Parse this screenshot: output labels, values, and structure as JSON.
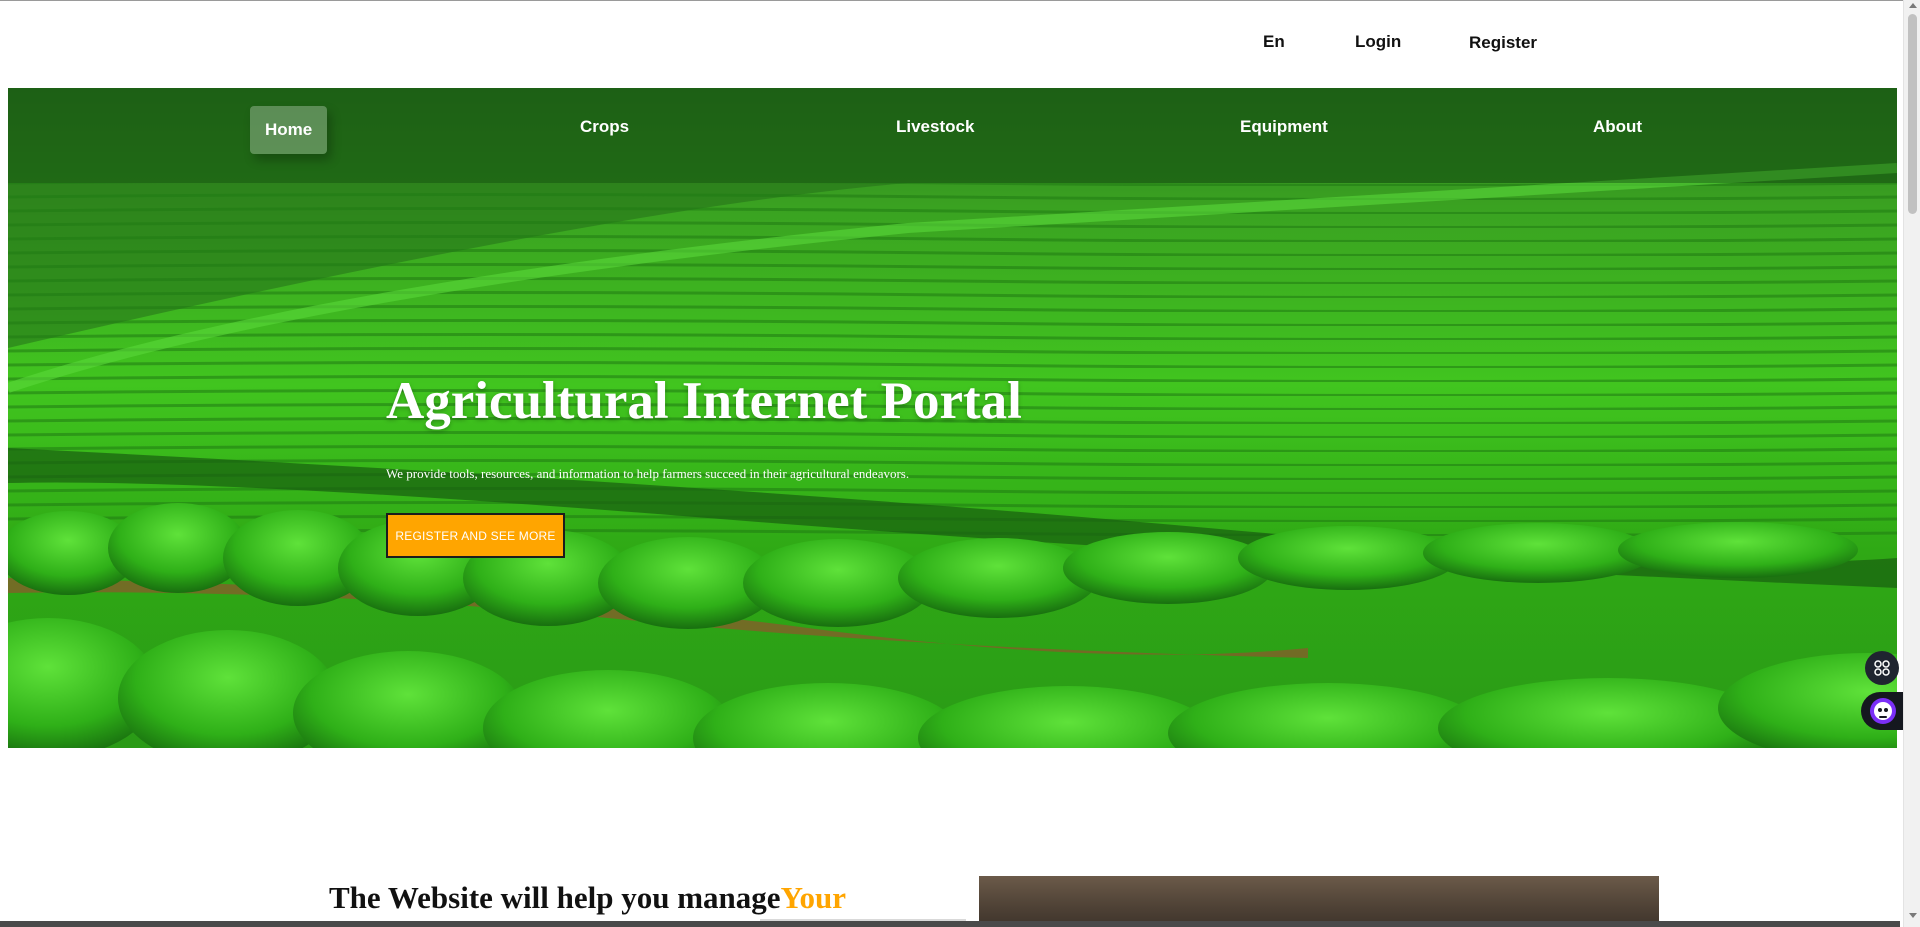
{
  "topbar": {
    "language": "En",
    "login": "Login",
    "register": "Register"
  },
  "nav": {
    "items": [
      {
        "label": "Home",
        "active": true
      },
      {
        "label": "Crops",
        "active": false
      },
      {
        "label": "Livestock",
        "active": false
      },
      {
        "label": "Equipment",
        "active": false
      },
      {
        "label": "About",
        "active": false
      }
    ]
  },
  "hero": {
    "title": "Agricultural Internet Portal",
    "subtitle": "We provide tools, resources, and information to help farmers succeed in their agricultural endeavors.",
    "cta": "REGISTER AND SEE MORE"
  },
  "section": {
    "title_main": "The Website will help you manage",
    "title_accent": "Your"
  },
  "icons": {
    "fab": "apps-grid-icon",
    "assistant": "assistant-bot-icon"
  },
  "colors": {
    "accent": "#ffa500",
    "field_green": "#33b81c",
    "nav_text": "#ffffff"
  }
}
